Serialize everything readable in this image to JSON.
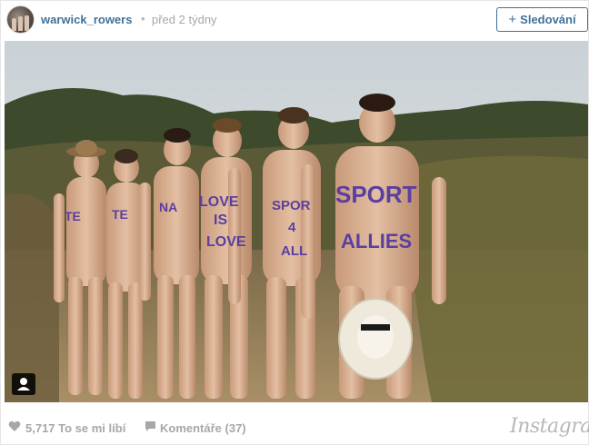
{
  "header": {
    "username": "warwick_rowers",
    "separator": "•",
    "timestamp": "před 2 týdny",
    "follow_label": "Sledování",
    "follow_icon": "plus-icon"
  },
  "photo": {
    "description_icon": "user-tag-icon",
    "body_paint": [
      {
        "text": "TE"
      },
      {
        "text": "TE"
      },
      {
        "text": "NA"
      },
      {
        "text": "LOVE IS LOVE"
      },
      {
        "text": "SPOR 4 ALL"
      },
      {
        "text": "SPORT ALLIES"
      }
    ]
  },
  "footer": {
    "likes_icon": "heart-icon",
    "likes_label": "5,717 To se mi líbí",
    "comments_icon": "comment-icon",
    "comments_label": "Komentáře (37)",
    "brand": "Instagram"
  },
  "colors": {
    "link": "#3f729b",
    "muted": "#a5a7aa",
    "paint": "#5a3fa0"
  }
}
